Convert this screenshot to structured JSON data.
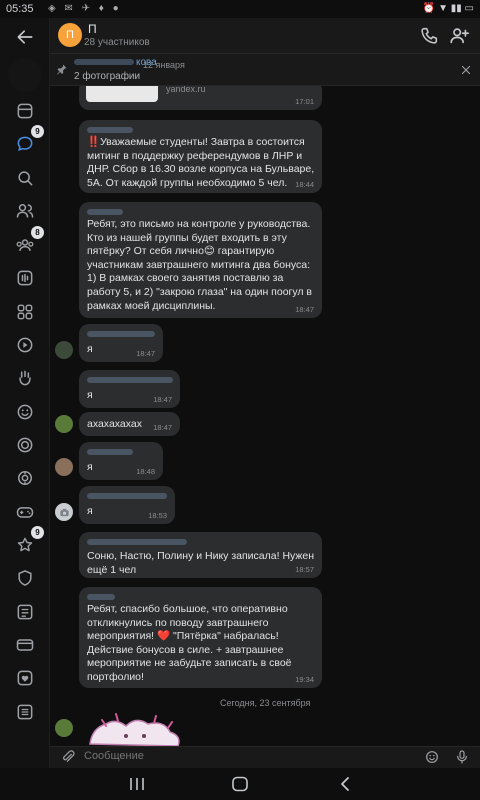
{
  "status": {
    "time": "05:35"
  },
  "header": {
    "avatar_letter": "П",
    "title": "П",
    "members": "28 участников"
  },
  "sidebar": {
    "items": [
      {
        "icon": "newsfeed-icon"
      },
      {
        "icon": "messages-icon",
        "badge": "9"
      },
      {
        "icon": "search-icon"
      },
      {
        "icon": "friends-icon"
      },
      {
        "icon": "communities-icon",
        "badge": "8"
      },
      {
        "icon": "music-icon"
      },
      {
        "icon": "services-icon"
      },
      {
        "icon": "video-icon"
      },
      {
        "icon": "clips-icon"
      },
      {
        "icon": "stickers-icon"
      },
      {
        "icon": "target-icon"
      },
      {
        "icon": "marusia-icon"
      },
      {
        "icon": "games-icon"
      },
      {
        "icon": "favorites-icon",
        "badge": "9"
      },
      {
        "icon": "shield-icon"
      },
      {
        "icon": "file-icon"
      },
      {
        "icon": "pay-icon"
      },
      {
        "icon": "liked-icon"
      },
      {
        "icon": "menu-icon"
      }
    ]
  },
  "pinned": {
    "author": "кова",
    "date": "12 января",
    "text": "2 фотографии"
  },
  "messages": [
    {
      "link": "yandex.ru",
      "time": "17:01"
    },
    {
      "lines": [
        "‼️Уважаемые студенты! Завтра в состоится",
        "митинг в поддержку референдумов в ЛНР и",
        "ДНР. Сбор  в 16.30 возле корпуса на Бульваре,",
        "5А. От каждой группы необходимо 5 чел."
      ],
      "time": "18:44"
    },
    {
      "lines": [
        "Ребят, это письмо на контроле у руководства.",
        "Кто из нашей группы будет входить в эту",
        "пятёрку? От себя лично😊 гарантирую",
        "участникам завтрашнего митинга два бонуса:",
        "1) В рамках своего занятия поставлю за",
        "работу 5, и 2) \"закрою глаза\" на один поогул в",
        "рамках моей дисциплины."
      ],
      "time": "18:47"
    },
    {
      "lines": [
        "я"
      ],
      "time": "18:47"
    },
    {
      "lines": [
        "я"
      ],
      "time": "18:47"
    },
    {
      "lines": [
        "ахахахахах"
      ],
      "time": "18:47"
    },
    {
      "lines": [
        "я"
      ],
      "time": "18:48"
    },
    {
      "lines": [
        "я"
      ],
      "time": "18:53"
    },
    {
      "lines": [
        "Соню, Настю, Полину и Нику записала! Нужен",
        "ещё 1 чел"
      ],
      "time": "18:57"
    },
    {
      "lines": [
        "Ребят, спасибо большое, что оперативно",
        "откликнулись по поводу завтрашнего",
        "мероприятия! ❤️ \"Пятёрка\" набралась!",
        "Действие бонусов в силе. + завтрашнее",
        "мероприятие не забудьте записать в своё",
        "портфолио!"
      ],
      "time": "19:34"
    }
  ],
  "date_separator": "Сегодня, 23 сентября",
  "composer": {
    "placeholder": "Сообщение"
  },
  "colors": {
    "accent": "#6f9fd0",
    "bubble": "#2c2d2e",
    "background": "#0e0e0e",
    "avatar": "#f7a23b"
  }
}
